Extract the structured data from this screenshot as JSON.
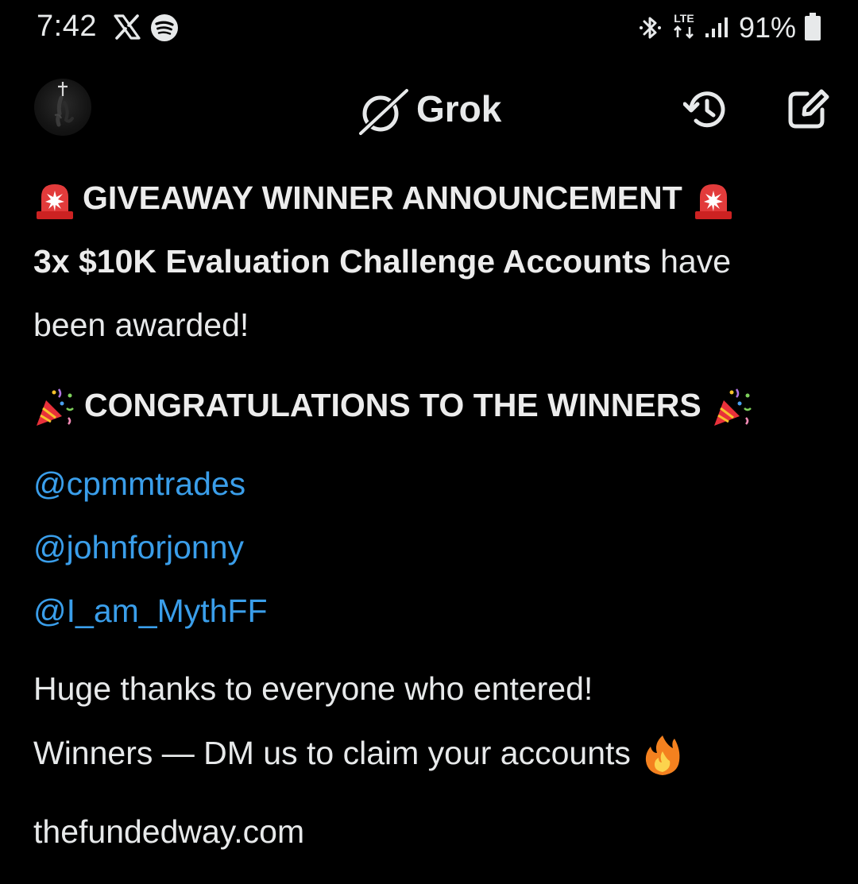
{
  "status_bar": {
    "time": "7:42",
    "network": "LTE",
    "battery": "91%",
    "icons": [
      "x-logo-icon",
      "spotify-icon",
      "bluetooth-icon",
      "lte-icon",
      "signal-icon",
      "battery-icon"
    ]
  },
  "header": {
    "title": "Grok",
    "icons": [
      "avatar",
      "grok-logo-icon",
      "history-icon",
      "new-chat-icon"
    ]
  },
  "message": {
    "headline": "GIVEAWAY WINNER ANNOUNCEMENT",
    "award_bold": "3x $10K Evaluation Challenge Accounts",
    "award_rest_1": " have",
    "award_line_2": "been awarded!",
    "congrats": "CONGRATULATIONS TO THE WINNERS",
    "winners": [
      "@cpmmtrades",
      "@johnforjonny",
      "@I_am_MythFF"
    ],
    "thanks": "Huge thanks to everyone who entered!",
    "claim": "Winners — DM us to claim your accounts",
    "website": "thefundedway.com",
    "emoji_names": [
      "siren-icon",
      "party-popper-icon",
      "fire-icon"
    ]
  },
  "colors": {
    "background": "#000000",
    "text": "#e7e9ea",
    "mention": "#3a9eea"
  }
}
